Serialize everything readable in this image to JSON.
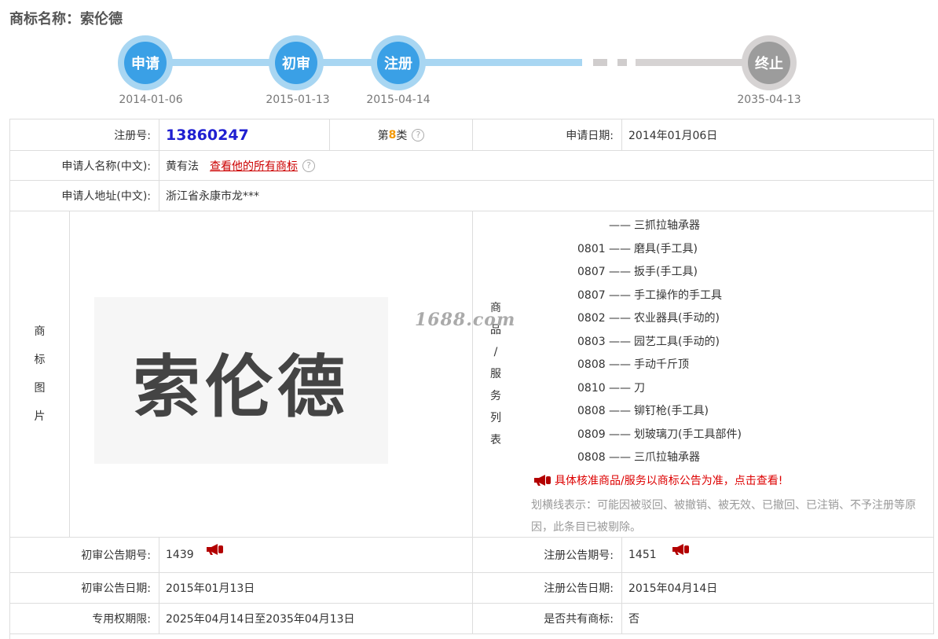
{
  "page": {
    "title": "商标名称：索伦德"
  },
  "timeline": [
    {
      "label": "申请",
      "date": "2014-01-06",
      "state": "active"
    },
    {
      "label": "初审",
      "date": "2015-01-13",
      "state": "active"
    },
    {
      "label": "注册",
      "date": "2015-04-14",
      "state": "active"
    },
    {
      "label": "终止",
      "date": "2035-04-13",
      "state": "future"
    }
  ],
  "info": {
    "reg_no_label": "注册号:",
    "reg_no": "13860247",
    "class_prefix": "第",
    "class_no": "8",
    "class_suffix": "类",
    "apply_date_label": "申请日期:",
    "apply_date": "2014年01月06日",
    "applicant_label": "申请人名称(中文):",
    "applicant": "黄有法",
    "applicant_link": "查看他的所有商标",
    "address_label": "申请人地址(中文):",
    "address": "浙江省永康市龙***",
    "image_label_chars": [
      "商",
      "标",
      "图",
      "片"
    ],
    "trademark_text": "索伦德",
    "watermark": "1688.com",
    "goods_label_chars": [
      "商",
      "品",
      "/",
      "服",
      "务",
      "列",
      "表"
    ],
    "goods": [
      {
        "code": "",
        "name": "三抓拉轴承器"
      },
      {
        "code": "0801",
        "name": "磨具(手工具)"
      },
      {
        "code": "0807",
        "name": "扳手(手工具)"
      },
      {
        "code": "0807",
        "name": "手工操作的手工具"
      },
      {
        "code": "0802",
        "name": "农业器具(手动的)"
      },
      {
        "code": "0803",
        "name": "园艺工具(手动的)"
      },
      {
        "code": "0808",
        "name": "手动千斤顶"
      },
      {
        "code": "0810",
        "name": "刀"
      },
      {
        "code": "0808",
        "name": "铆钉枪(手工具)"
      },
      {
        "code": "0809",
        "name": "划玻璃刀(手工具部件)"
      },
      {
        "code": "0808",
        "name": "三爪拉轴承器"
      }
    ],
    "goods_dash": "——",
    "goods_notice": "具体核准商品/服务以商标公告为准，点击查看!",
    "goods_hint": "划横线表示：可能因被驳回、被撤销、被无效、已撤回、已注销、不予注册等原因，此条目已被剔除。",
    "prelim_no_label": "初审公告期号:",
    "prelim_no": "1439",
    "reg_pub_no_label": "注册公告期号:",
    "reg_pub_no": "1451",
    "prelim_date_label": "初审公告日期:",
    "prelim_date": "2015年01月13日",
    "reg_pub_date_label": "注册公告日期:",
    "reg_pub_date": "2015年04月14日",
    "exclusive_label": "专用权期限:",
    "exclusive": "2025年04月14日至2035年04月13日",
    "shared_label": "是否共有商标:",
    "shared": "否"
  }
}
